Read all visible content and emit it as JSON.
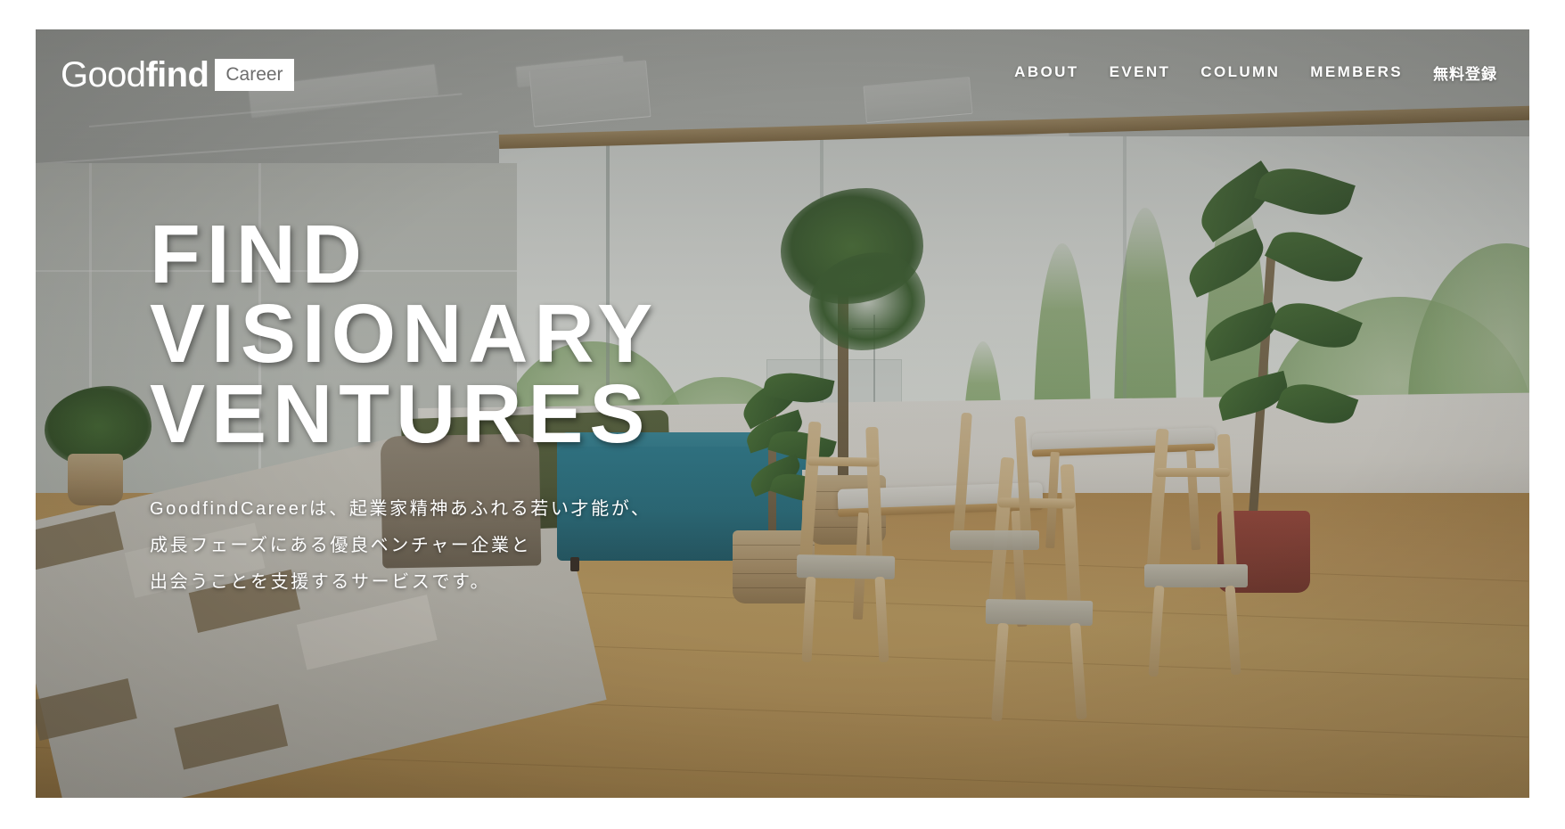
{
  "brand": {
    "logo_primary_light": "Good",
    "logo_primary_bold": "find",
    "logo_badge": "Career",
    "badge_bg": "#ffffff",
    "badge_text_color": "#6d6d6d"
  },
  "nav": {
    "items": [
      {
        "label": "ABOUT",
        "name": "nav-item-about",
        "lang": "en"
      },
      {
        "label": "EVENT",
        "name": "nav-item-event",
        "lang": "en"
      },
      {
        "label": "COLUMN",
        "name": "nav-item-column",
        "lang": "en"
      },
      {
        "label": "MEMBERS",
        "name": "nav-item-members",
        "lang": "en"
      },
      {
        "label": "無料登録",
        "name": "nav-item-register",
        "lang": "ja"
      }
    ]
  },
  "hero": {
    "headline_line1": "FIND",
    "headline_line2": "VISIONARY",
    "headline_line3": "VENTURES",
    "lead_line1": "GoodfindCareerは、起業家精神あふれる若い才能が、",
    "lead_line2": "成長フェーズにある優良ベンチャー企業と",
    "lead_line3": "出会うことを支援するサービスです。",
    "text_color": "#ffffff",
    "overlay_tint": "#3a3a36"
  },
  "scene": {
    "description": "office lounge interior",
    "colors": {
      "teal_sofa": "#2a7688",
      "green_sofa": "#55603c",
      "wood_floor": "#c8a263",
      "carpet": "#d2cfc6",
      "carpet_accent": "#8c7a5c",
      "ceiling": "#c7cac6",
      "window_light": "#eef2ed",
      "foliage": "#83a96c"
    }
  }
}
